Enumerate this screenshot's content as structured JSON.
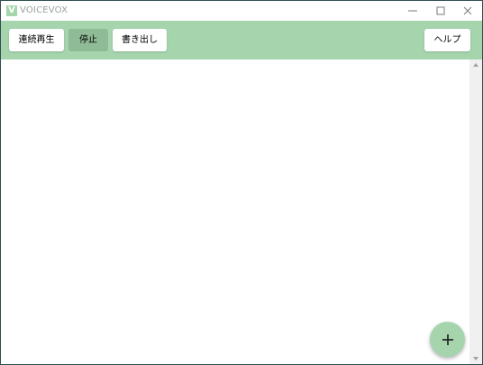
{
  "window": {
    "title": "VOICEVOX",
    "icon_letter": "V"
  },
  "toolbar": {
    "play_all_label": "連続再生",
    "stop_label": "停止",
    "export_label": "書き出し",
    "help_label": "ヘルプ"
  },
  "icons": {
    "minimize": "minimize-icon",
    "maximize": "maximize-icon",
    "close": "close-icon",
    "add": "plus-icon",
    "scroll_up": "chevron-up-icon",
    "scroll_down": "chevron-down-icon"
  },
  "colors": {
    "accent": "#a5d4ad",
    "accent_dark": "#8fbc97",
    "window_border": "#2f4f4f",
    "title_text": "#9aa0a0"
  }
}
